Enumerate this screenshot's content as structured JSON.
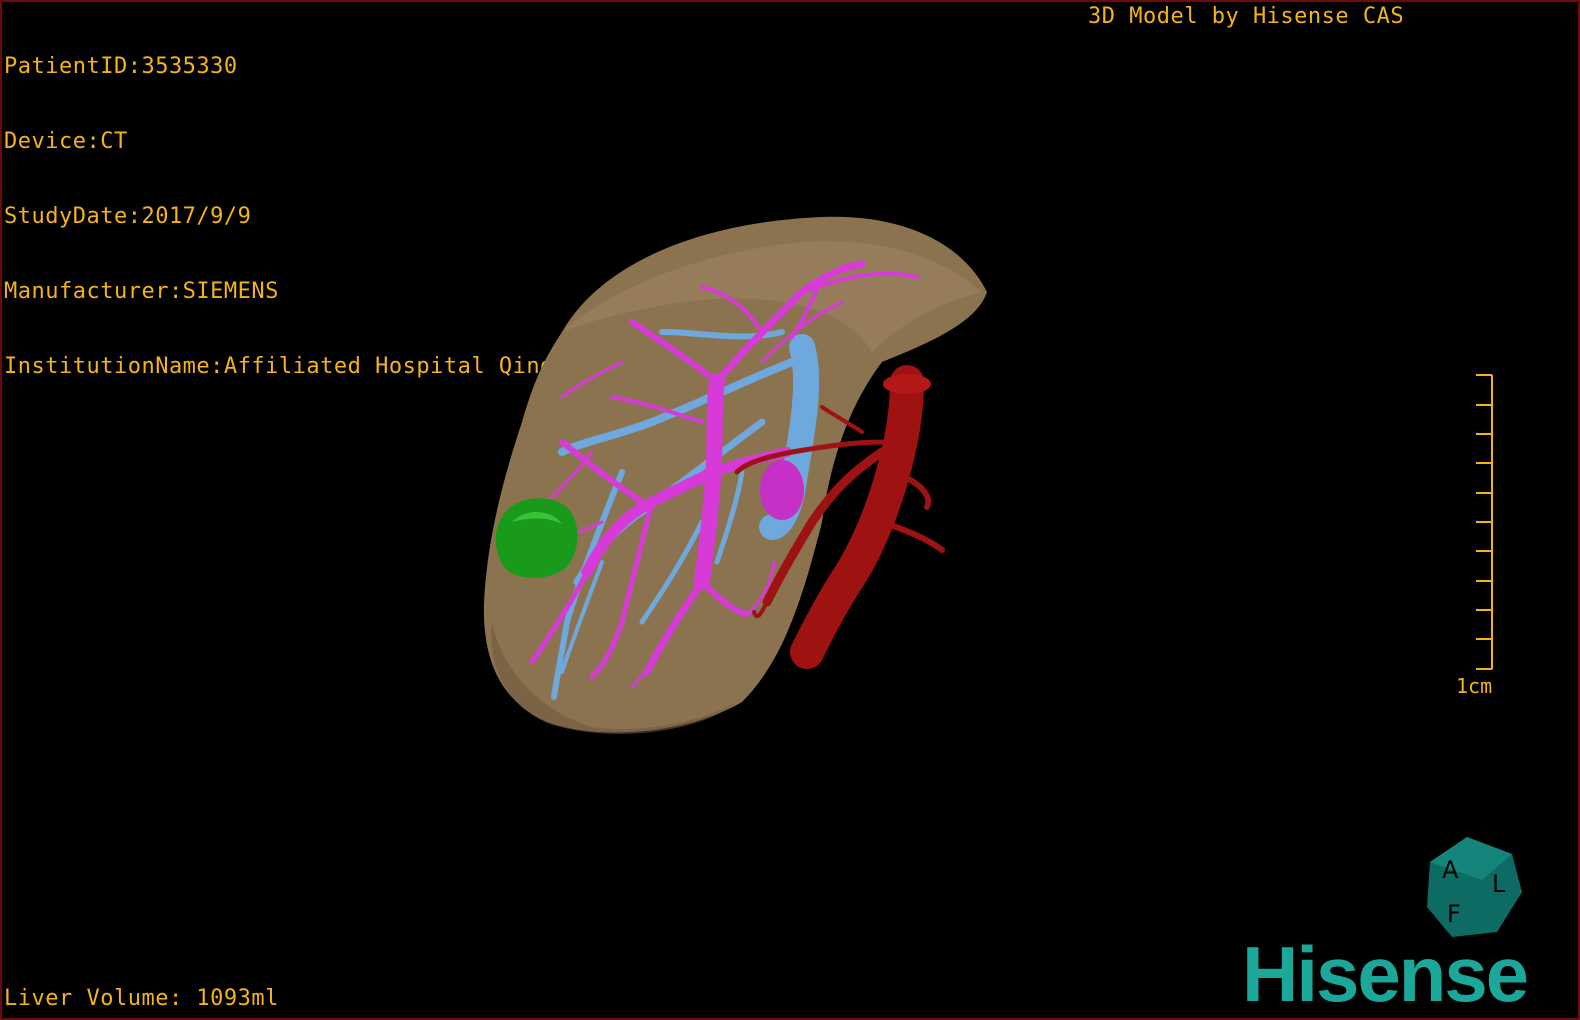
{
  "info": {
    "patient_id": "PatientID:3535330",
    "device": "Device:CT",
    "study_date": "StudyDate:2017/9/9",
    "manufacturer": "Manufacturer:SIEMENS",
    "institution": "InstitutionName:Affiliated Hospital Qingdao University-C"
  },
  "brand_title": "3D Model by Hisense CAS",
  "liver_volume": "Liver Volume: 1093ml",
  "scale": {
    "label": "1cm"
  },
  "cube": {
    "labels": [
      "A",
      "F",
      "L"
    ]
  },
  "logo": "Hisense",
  "colors": {
    "overlay_text": "#f4b21b",
    "liver": "#8c7350",
    "portal_vein": "#d73ad8",
    "hepatic_vein": "#6fa8dc",
    "artery": "#9e1212",
    "tumor": "#1a9a1a",
    "logo": "#1ba79a"
  }
}
